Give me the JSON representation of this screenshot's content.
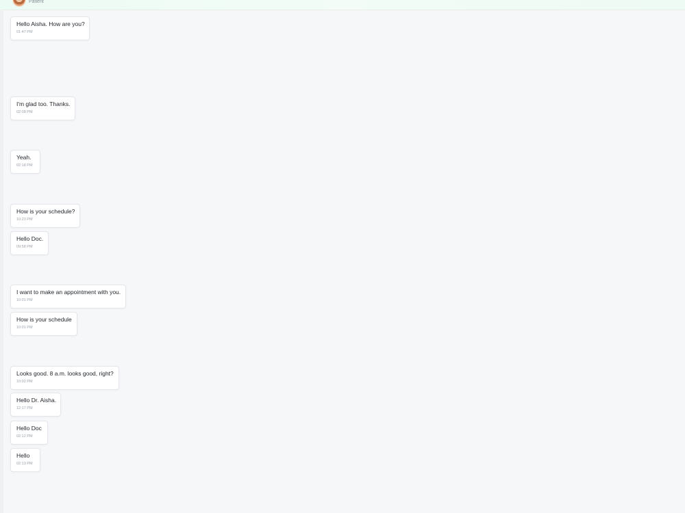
{
  "header": {
    "role": "Patient"
  },
  "messages": [
    {
      "text": "Hello Aisha. How are you?",
      "time": "01:47 PM"
    },
    {
      "text": "I'm glad too. Thanks.",
      "time": "02:08 PM"
    },
    {
      "text": "Yeah.",
      "time": "02:18 PM"
    },
    {
      "text": "How is your schedule?",
      "time": "10:23 PM"
    },
    {
      "text": "Hello Doc.",
      "time": "09:58 PM"
    },
    {
      "text": "I want to make an appointment with you.",
      "time": "10:01 PM"
    },
    {
      "text": "How is your schedule",
      "time": "10:01 PM"
    },
    {
      "text": "Looks good. 8 a.m. looks good, right?",
      "time": "10:02 PM"
    },
    {
      "text": "Hello Dr. Aisha.",
      "time": "12:17 PM"
    },
    {
      "text": "Hello Doc",
      "time": "02:12 PM"
    },
    {
      "text": "Hello",
      "time": "02:13 PM"
    }
  ]
}
